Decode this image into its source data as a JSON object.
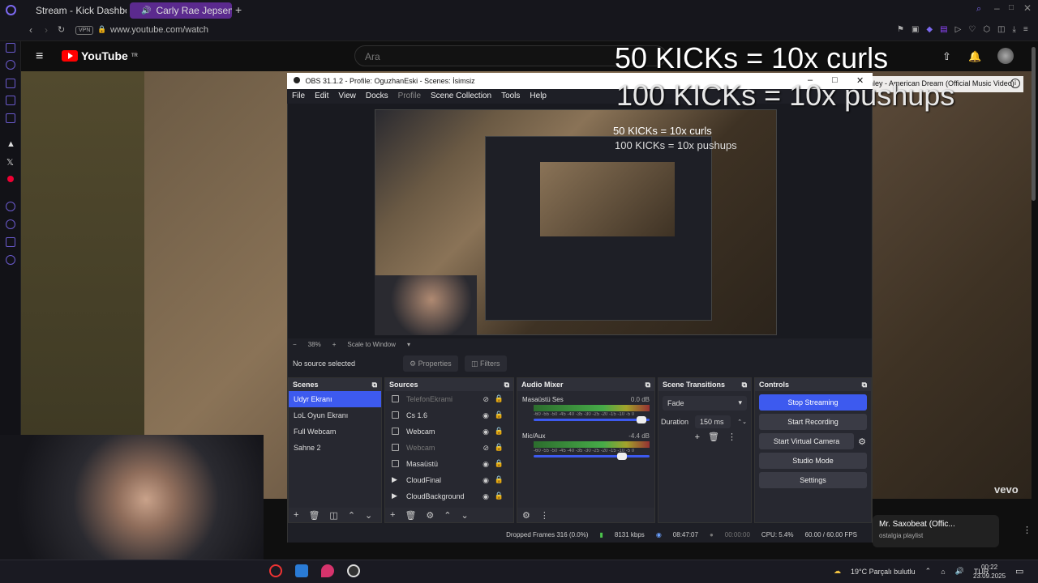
{
  "browser": {
    "tabs": [
      {
        "label": "Stream - Kick Dashboard"
      },
      {
        "label": "Carly Rae Jepsen - Ca"
      }
    ],
    "url": "www.youtube.com/watch",
    "vpn_label": "VPN"
  },
  "youtube": {
    "logo": "YouTube",
    "region": "TR",
    "search_placeholder": "Ara",
    "video_title_overlay": "nley - American Dream (Official Music Video)",
    "vevo": "vevo",
    "miniplayer": {
      "title": "Mr. Saxobeat (Offic...",
      "subtitle": "ostalgia playlist"
    }
  },
  "overlay": {
    "line1": "50 KICKs = 10x curls",
    "line2": "100 KICKs = 10x pushups"
  },
  "obs": {
    "title": "OBS 31.1.2 - Profile: OguzhanEski - Scenes: İsimsiz",
    "menu": [
      "File",
      "Edit",
      "View",
      "Docks",
      "Profile",
      "Scene Collection",
      "Tools",
      "Help"
    ],
    "zoom": "38%",
    "scale_mode": "Scale to Window",
    "no_source": "No source selected",
    "properties": "Properties",
    "filters": "Filters",
    "scenes": {
      "header": "Scenes",
      "items": [
        "Udyr Ekranı",
        "LoL Oyun Ekranı",
        "Full Webcam",
        "Sahne 2"
      ]
    },
    "sources": {
      "header": "Sources",
      "items": [
        "TelefonEkrami",
        "Cs 1.6",
        "Webcam",
        "Webcam",
        "Masaüstü",
        "CloudFinal",
        "CloudBackground"
      ]
    },
    "mixer": {
      "header": "Audio Mixer",
      "tracks": [
        {
          "name": "Masaüstü Ses",
          "db": "0.0 dB",
          "fader": 0.97
        },
        {
          "name": "Mic/Aux",
          "db": "-4.4 dB",
          "fader": 0.79
        }
      ],
      "scale": "-60 -55 -50 -45 -40 -35 -30 -25 -20 -15 -10 -5 0"
    },
    "transitions": {
      "header": "Scene Transitions",
      "type": "Fade",
      "duration_label": "Duration",
      "duration_value": "150 ms"
    },
    "controls": {
      "header": "Controls",
      "stop_streaming": "Stop Streaming",
      "start_recording": "Start Recording",
      "start_virtual_camera": "Start Virtual Camera",
      "studio_mode": "Studio Mode",
      "settings": "Settings"
    },
    "status": {
      "dropped_frames": "Dropped Frames 316 (0.0%)",
      "bitrate": "8131 kbps",
      "stream_time": "08:47:07",
      "rec_time": "00:00:00",
      "cpu": "CPU: 5.4%",
      "fps": "60.00 / 60.00 FPS"
    },
    "preview_overlay": {
      "line1": "50 KICKs = 10x curls",
      "line2": "100 KICKs = 10x pushups"
    }
  },
  "taskbar": {
    "weather": "19°C  Parçalı bulutlu",
    "lang": "TUR",
    "time": "00:22",
    "date": "23.09.2025"
  },
  "colors": {
    "accent": "#3d5aef",
    "tab_active": "#5b2a8e",
    "youtube_red": "#ff0000"
  }
}
